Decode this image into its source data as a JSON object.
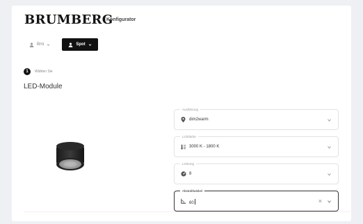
{
  "header": {
    "brand": "BRUMBERG",
    "subtitle": "Konfigurator"
  },
  "modes": [
    {
      "label": "Bmi",
      "icon": "person-icon",
      "active": false
    },
    {
      "label": "Spot",
      "icon": "person-icon",
      "active": true
    }
  ],
  "step": {
    "number": "1",
    "hint": "Wählen Sie",
    "title": "LED-Module"
  },
  "product": {
    "image": "led-module-image"
  },
  "fields": [
    {
      "label": "Ausführung",
      "value": "dim2warm",
      "icon": "pin-icon"
    },
    {
      "label": "Lichtfarbe",
      "value": "3000 K - 1800 K",
      "icon": "thermometer-icon"
    },
    {
      "label": "Leistung",
      "value": "8",
      "icon": "gauge-icon"
    },
    {
      "label": "Abstrahlwinkel",
      "value": "60",
      "icon": "angle-icon",
      "focused": true
    }
  ],
  "colors": {
    "background": "#eff0f3",
    "card": "#ffffff",
    "accent": "#111111"
  }
}
